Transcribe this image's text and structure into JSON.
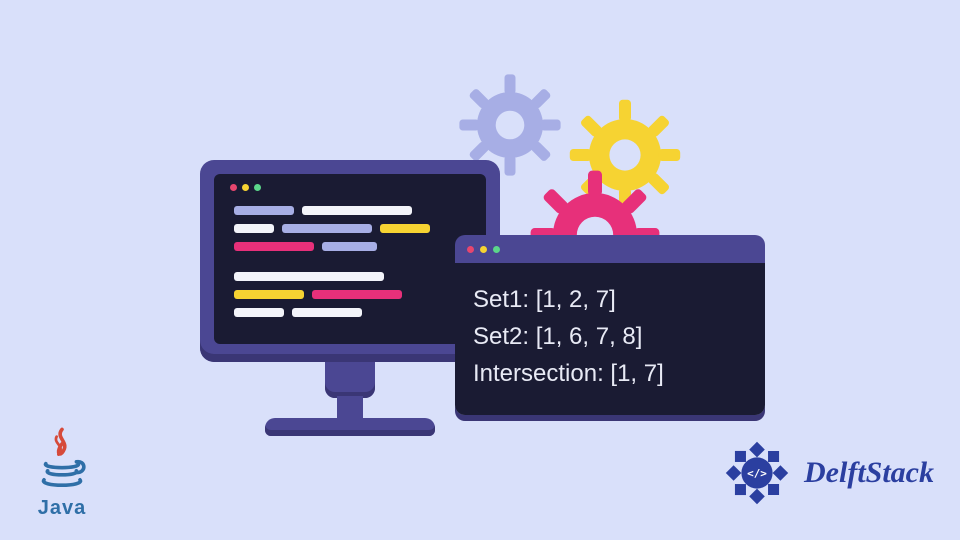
{
  "terminal": {
    "line1": "Set1: [1, 2, 7]",
    "line2": "Set2: [1, 6, 7, 8]",
    "line3": "Intersection: [1, 7]"
  },
  "logos": {
    "java": "Java",
    "delft": "DelftStack"
  },
  "gears": {
    "lavender": "#a7aee5",
    "yellow": "#f6d332",
    "magenta": "#e7307a"
  }
}
